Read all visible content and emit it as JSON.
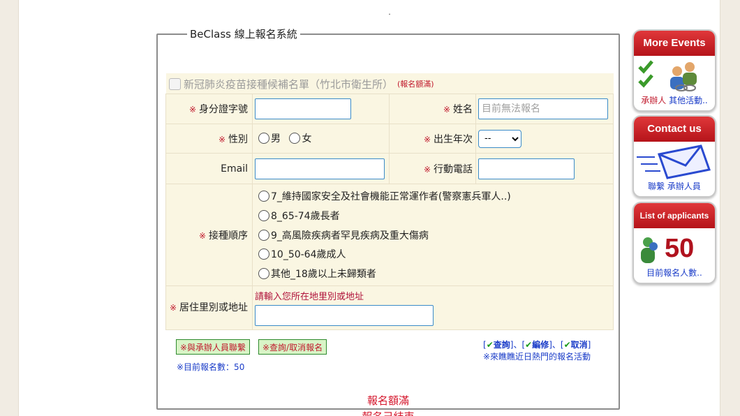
{
  "dot": "˙",
  "form": {
    "legend": "BeClass 線上報名系統",
    "vaccine_label": "新冠肺炎疫苗接種候補名單（竹北市衛生所）",
    "full_badge": "(報名額滿)",
    "star": "※",
    "id_label": "身分證字號",
    "name_label": "姓名",
    "name_placeholder": "目前無法報名",
    "gender_label": "性別",
    "male": "男",
    "female": "女",
    "birth_label": "出生年次",
    "birth_value": "--",
    "email_label": "Email",
    "phone_label": "行動電話",
    "order_label": "接種順序",
    "order_options": [
      "7_維持國家安全及社會機能正常運作者(警察憲兵軍人..)",
      "8_65-74歲長者",
      "9_高風險疾病者罕見疾病及重大傷病",
      "10_50-64歲成人",
      "其他_18歲以上未歸類者"
    ],
    "address_label": "居住里別或地址",
    "address_hint": "請輸入您所在地里別或地址"
  },
  "actions": {
    "contact_button": "※與承辦人員聯繫",
    "query_button": "※查詢/取消報名",
    "count_text": "※目前報名數：50",
    "link_query": "查詢",
    "link_edit": "編修",
    "link_cancel": "取消",
    "hot_events": "※來瞧瞧近日熱門的報名活動",
    "full_text": "報名額滿",
    "ended_text": "報名己結束"
  },
  "sidebar": {
    "more_events": "More Events",
    "organizer": "承辦人",
    "other_events": "其他活動..",
    "contact_us": "Contact us",
    "contact_staff": "聯繫 承辦人員",
    "list_applicants": "List of applicants",
    "applicant_count": "50",
    "current_count": "目前報名人數.."
  }
}
